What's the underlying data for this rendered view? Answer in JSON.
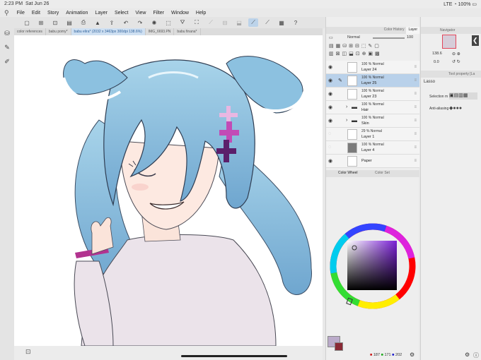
{
  "status": {
    "time": "2:23 PM",
    "date": "Sat Jun 26",
    "carrier": "LTE",
    "battery": "100%"
  },
  "menu": [
    "File",
    "Edit",
    "Story",
    "Animation",
    "Layer",
    "Select",
    "View",
    "Filter",
    "Window",
    "Help"
  ],
  "tabs": [
    "color references",
    "babu pomy*",
    "babu elira* (2032 x 3463px 300dpi 138.6%)",
    "IMG_6693.PN",
    "babu finana*"
  ],
  "layer_panel": {
    "tab_history": "Color History",
    "tab_layer": "Layer",
    "blend_mode": "Normal",
    "opacity": "100",
    "layers": [
      {
        "pct": "100 %  Normal",
        "name": "Layer 24",
        "selected": false
      },
      {
        "pct": "100 %  Normal",
        "name": "Layer 25",
        "selected": true
      },
      {
        "pct": "100 %  Normal",
        "name": "Layer 23",
        "selected": false
      },
      {
        "pct": "100 %  Normal",
        "name": "Hair",
        "selected": false
      },
      {
        "pct": "100 %  Normal",
        "name": "Skin",
        "selected": false
      },
      {
        "pct": "29 %  Normal",
        "name": "Layer 1",
        "selected": false
      },
      {
        "pct": "100 %  Normal",
        "name": "Layer 4",
        "selected": false
      },
      {
        "pct": "",
        "name": "Paper",
        "selected": false
      }
    ]
  },
  "color_panel": {
    "tab_wheel": "Color Wheel",
    "tab_set": "Color Set",
    "r": "187",
    "g": "171",
    "b": "202",
    "main_color": "#bbabca",
    "sub_color": "#8a2a35"
  },
  "navigator": {
    "title": "Navigator",
    "zoom": "138.6",
    "angle": "0.0"
  },
  "tool_property": {
    "title": "Tool property [La",
    "tool_name": "Lasso",
    "selection_label": "Selection m",
    "antialias_label": "Anti-aliasing"
  }
}
